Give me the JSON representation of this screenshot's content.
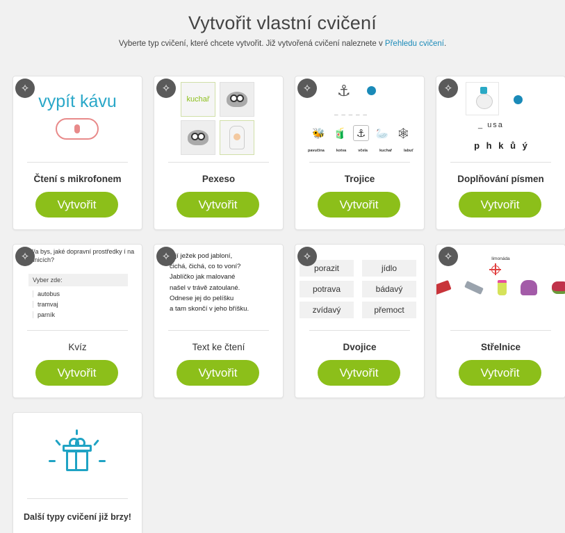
{
  "header": {
    "title": "Vytvořit vlastní cvičení",
    "subtitle_text": "Vyberte typ cvičení, které chcete vytvořit. Již vytvořená cvičení naleznete v ",
    "subtitle_link": "Přehledu cvičení",
    "subtitle_end": "."
  },
  "colors": {
    "accent_green": "#8cbf1a",
    "link_blue": "#1a8ab8",
    "mic_red": "#e88a8a",
    "gift_blue": "#1fa3c4"
  },
  "create_label": "Vytvořit",
  "cards": [
    {
      "title": "Čtení s mikrofonem",
      "preview": {
        "word": "vypít kávu",
        "icon": "microphone-icon"
      }
    },
    {
      "title": "Pexeso",
      "preview": {
        "tile_word": "kuchař",
        "icons": [
          "spider-icon",
          "spider-icon",
          "chef-icon"
        ]
      }
    },
    {
      "title": "Trojice",
      "preview": {
        "words": [
          "pavučina",
          "kotva",
          "včela",
          "kuchař",
          "labuť"
        ],
        "icons": [
          "bee-icon",
          "cup-icon",
          "anchor-icon",
          "swan-icon",
          "web-icon"
        ]
      }
    },
    {
      "title": "Doplňování písmen",
      "preview": {
        "word": "usa",
        "letters": "p h k ů ý",
        "icon": "goose-icon"
      }
    },
    {
      "title": "Kvíz",
      "preview": {
        "question": "ěl/a bys, jaké dopravní prostředky í na silnicích?",
        "prompt": "Vyber zde:",
        "options": [
          "autobus",
          "tramvaj",
          "parník"
        ]
      }
    },
    {
      "title": "Text ke čtení",
      "preview": {
        "lines": [
          "tojí ježek pod jabloní,",
          "čichá, čichá, co to voní?",
          "Jablíčko jak malované",
          "našel v trávě zatoulané.",
          "Odnese jej do pelíšku",
          "a tam skončí v jeho bříšku."
        ]
      }
    },
    {
      "title": "Dvojice",
      "preview": {
        "tiles": [
          "porazit",
          "jídlo",
          "potrava",
          "bádavý",
          "zvídavý",
          "přemoct"
        ]
      }
    },
    {
      "title": "Střelnice",
      "preview": {
        "label": "limonáda",
        "icons": [
          "candy-icon",
          "satellite-icon",
          "lemonade-icon",
          "backpack-icon",
          "glove-icon"
        ]
      }
    }
  ],
  "coming_soon": {
    "text": "Další typy cvičení již brzy!",
    "icon": "gift-icon"
  }
}
